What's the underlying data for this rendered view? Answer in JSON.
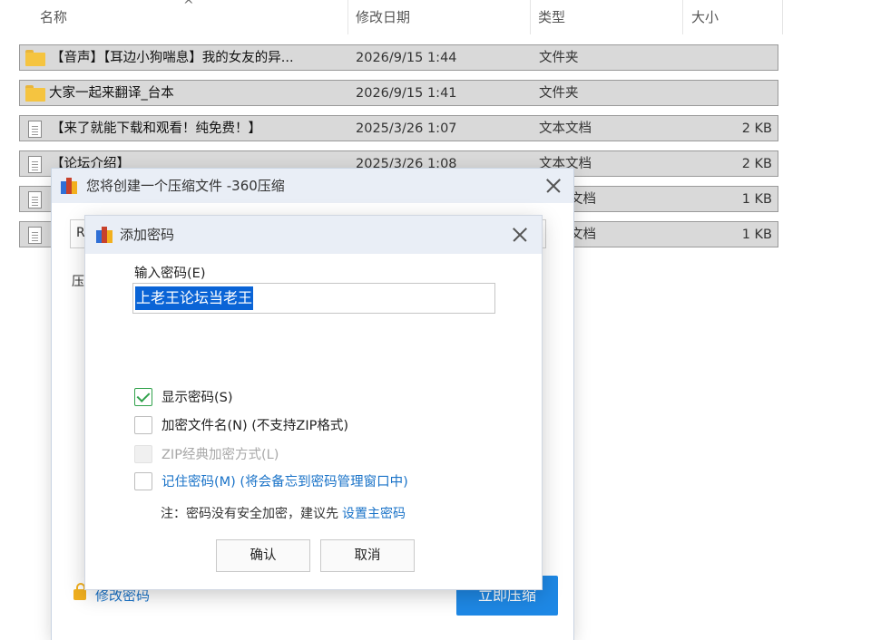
{
  "explorer": {
    "columns": {
      "name": "名称",
      "date": "修改日期",
      "type": "类型",
      "size": "大小"
    },
    "rows": [
      {
        "icon": "folder-icon",
        "name": "【音声】【耳边小狗喘息】我的女友的异...",
        "date": "2026/9/15 1:44",
        "type": "文件夹",
        "size": ""
      },
      {
        "icon": "folder-icon",
        "name": "大家一起来翻译_台本",
        "date": "2026/9/15 1:41",
        "type": "文件夹",
        "size": ""
      },
      {
        "icon": "document-icon",
        "name": "【来了就能下载和观看！纯免费！】",
        "date": "2025/3/26 1:07",
        "type": "文本文档",
        "size": "2 KB"
      },
      {
        "icon": "document-icon",
        "name": "【论坛介绍】",
        "date": "2025/3/26 1:08",
        "type": "文本文档",
        "size": "2 KB"
      },
      {
        "icon": "document-icon",
        "name": "",
        "date": "",
        "type": "文档",
        "size": "1 KB"
      },
      {
        "icon": "document-icon",
        "name": "",
        "date": "",
        "type": "文档",
        "size": "1 KB"
      }
    ]
  },
  "compress_dialog": {
    "title": "您将创建一个压缩文件 -360压缩",
    "field_prefix": "R",
    "field_label": "压",
    "change_password": "修改密码",
    "compress_now": "立即压缩"
  },
  "password_dialog": {
    "title": "添加密码",
    "input_label": "输入密码(E)",
    "password_value": "上老王论坛当老王",
    "options": [
      {
        "label": "显示密码(S)",
        "checked": true,
        "enabled": true
      },
      {
        "label": "加密文件名(N) (不支持ZIP格式)",
        "checked": false,
        "enabled": true
      },
      {
        "label": "ZIP经典加密方式(L)",
        "checked": false,
        "enabled": false
      },
      {
        "label": "记住密码(M) (将会备忘到密码管理窗口中)",
        "checked": false,
        "enabled": true
      }
    ],
    "note": "注：密码没有安全加密，建议先",
    "note_link": "设置主密码",
    "ok_button": "确认",
    "cancel_button": "取消"
  },
  "colors": {
    "accent_blue": "#1e88e5",
    "link_blue": "#1a73c8",
    "checkbox_green": "#31a24c",
    "selection_blue": "#0a64d6",
    "titlebar_bg": "#e9eef6",
    "row_highlight": "#d9d9d9"
  }
}
